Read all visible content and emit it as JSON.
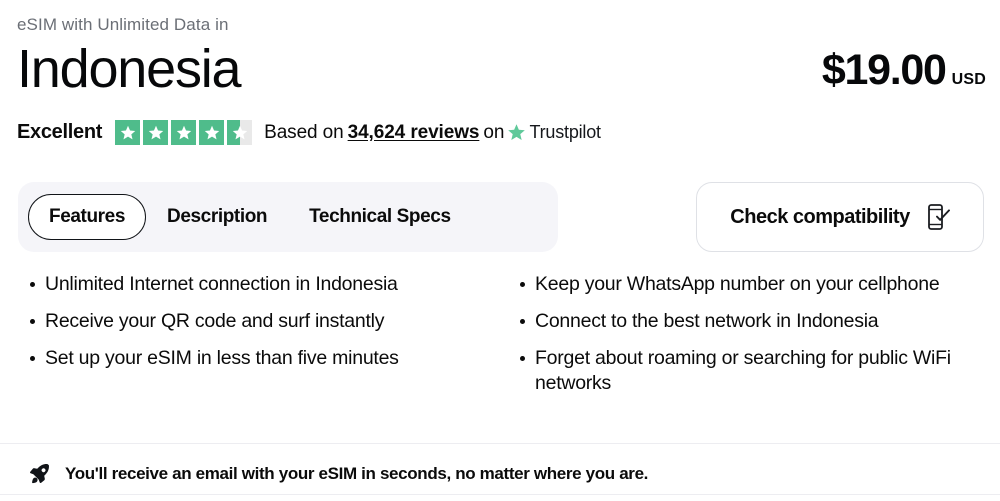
{
  "header": {
    "eyebrow": "eSIM with Unlimited Data in",
    "country": "Indonesia",
    "price": "$19.00",
    "currency": "USD"
  },
  "trustpilot": {
    "rating_word": "Excellent",
    "stars_total": 5,
    "stars_filled": 4.5,
    "star_fill_color": "#4fbc8b",
    "star_empty_color": "#e9e9e9",
    "based_on_label": "Based on",
    "reviews_count": "34,624 reviews",
    "on_label": "on",
    "brand_name": "Trustpilot",
    "brand_icon": "trustpilot-star-icon"
  },
  "tabs": {
    "items": [
      {
        "label": "Features",
        "active": true
      },
      {
        "label": "Description",
        "active": false
      },
      {
        "label": "Technical Specs",
        "active": false
      }
    ]
  },
  "compatibility": {
    "label": "Check compatibility",
    "icon": "phone-check-icon"
  },
  "features": {
    "left_column": [
      "Unlimited Internet connection in Indonesia",
      "Receive your QR code and surf instantly",
      "Set up your eSIM in less than five minutes"
    ],
    "right_column": [
      "Keep your WhatsApp number on your cellphone",
      "Connect to the best network in Indonesia",
      "Forget about roaming or searching for public WiFi networks"
    ]
  },
  "footer": {
    "icon": "rocket-icon",
    "note": "You'll receive an email with your eSIM in seconds, no matter where you are."
  }
}
